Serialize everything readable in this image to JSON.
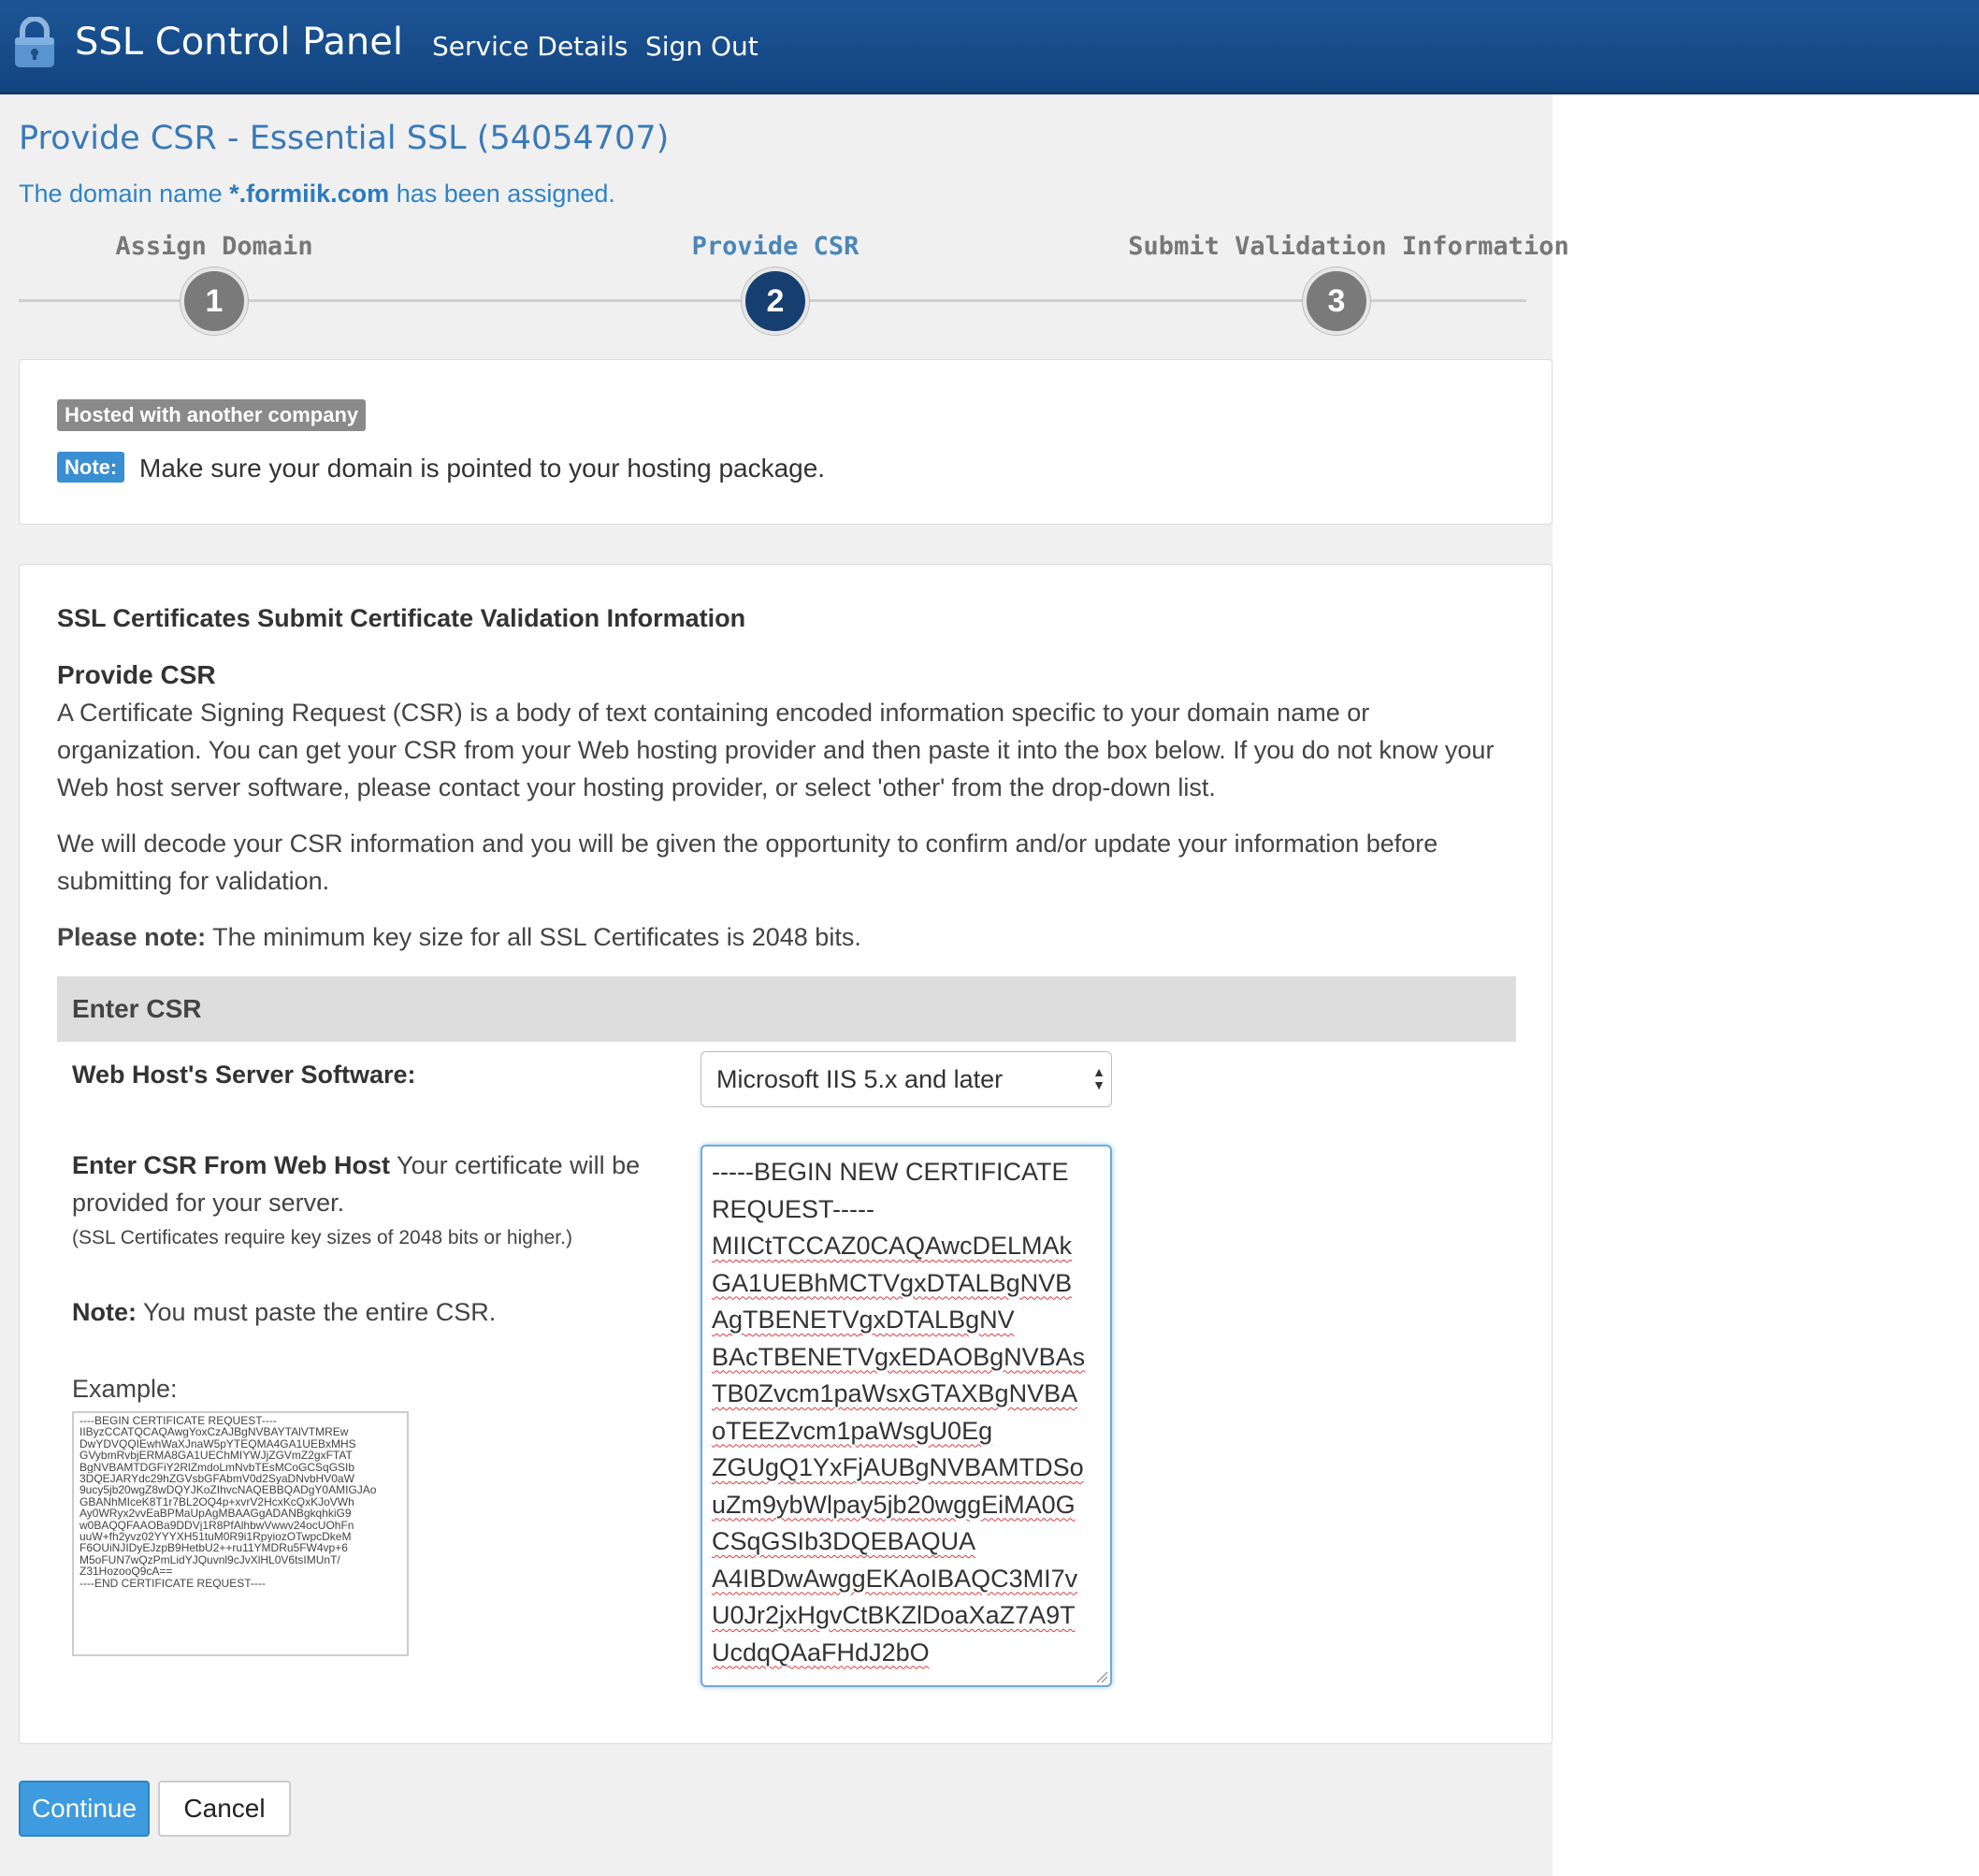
{
  "nav": {
    "brand": "SSL Control Panel",
    "links": [
      "Service Details",
      "Sign Out"
    ]
  },
  "page": {
    "title": "Provide CSR - Essential SSL (54054707)",
    "assigned_prefix": "The domain name",
    "assigned_domain": "*.formiik.com",
    "assigned_suffix": "has been assigned."
  },
  "steps": [
    {
      "number": "1",
      "label": "Assign Domain",
      "state": "done"
    },
    {
      "number": "2",
      "label": "Provide CSR",
      "state": "active"
    },
    {
      "number": "3",
      "label": "Submit Validation Information",
      "state": "pending"
    }
  ],
  "hosting_panel": {
    "badge": "Hosted with another company",
    "note_badge": "Note:",
    "note_text": "Make sure your domain is pointed to your hosting package."
  },
  "csr_panel": {
    "title": "SSL Certificates Submit Certificate Validation Information",
    "heading": "Provide CSR",
    "intro": "A Certificate Signing Request (CSR) is a body of text containing encoded information specific to your domain name or organization. You can get your CSR from your Web hosting provider and then paste it into the box below. If you do not know your Web host server software, please contact your hosting provider, or select 'other' from the drop-down list.",
    "decode": "We will decode your CSR information and you will be given the opportunity to confirm and/or update your information before submitting for validation.",
    "please_note_label": "Please note:",
    "please_note_text": "The minimum key size for all SSL Certificates is 2048 bits.",
    "enter_csr_header": "Enter CSR",
    "server_software_label": "Web Host's Server Software:",
    "server_software_value": "Microsoft IIS 5.x and later",
    "enter_csr_label": "Enter CSR From Web Host",
    "enter_csr_desc": "Your certificate will be provided for your server.",
    "key_size_hint": "(SSL Certificates require key sizes of 2048 bits or higher.)",
    "note_label": "Note:",
    "note_text": "You must paste the entire CSR.",
    "example_label": "Example:",
    "example_lines": [
      "----BEGIN CERTIFICATE REQUEST----",
      "IIByzCCATQCAQAwgYoxCzAJBgNVBAYTAlVTMREw",
      "DwYDVQQIEwhWaXJnaW5pYTEQMA4GA1UEBxMHS",
      "GVybmRvbjERMA8GA1UEChMIYWJjZGVmZ2gxFTAT",
      "BgNVBAMTDGFiY2RlZmdoLmNvbTEsMCoGCSqGSIb",
      "3DQEJARYdc29hZGVsbGFAbmV0d2SyaDNvbHV0aW",
      "9ucy5jb20wgZ8wDQYJKoZIhvcNAQEBBQADgY0AMIGJAo",
      "GBANhMIceK8T1r7BL2OQ4p+xvrV2HcxKcQxKJoVWh",
      "Ay0WRyx2vvEaBPMaUpAgMBAAGgADANBgkqhkiG9",
      "w0BAQQFAAOBa9DDVj1R8PfAlhbwVwwv24ocUOhFn",
      "uuW+fh2yvz02YYYXH51tuM0R9i1RpyiozOTwpcDkeM",
      "F6OUiNJIDyEJzpB9HetbU2++ru11YMDRu5FW4vp+6",
      "M5oFUN7wQzPmLidYJQuvnl9cJvXlHL0V6tsIMUnT/",
      "Z31HozooQ9cA==",
      "----END CERTIFICATE REQUEST----"
    ],
    "csr_lines": [
      "-----BEGIN NEW CERTIFICATE",
      "REQUEST-----",
      "MIICtTCCAZ0CAQAwcDELMAk",
      "GA1UEBhMCTVgxDTALBgNVB",
      "AgTBENETVgxDTALBgNV",
      "BAcTBENETVgxEDAOBgNVBAs",
      "TB0Zvcm1paWsxGTAXBgNVBA",
      "oTEEZvcm1paWsgU0Eg",
      "ZGUgQ1YxFjAUBgNVBAMTDSo",
      "uZm9ybWlpay5jb20wggEiMA0G",
      "CSqGSIb3DQEBAQUA",
      "A4IBDwAwggEKAoIBAQC3MI7v",
      "U0Jr2jxHgvCtBKZlDoaXaZ7A9T",
      "UcdqQAaFHdJ2bO"
    ]
  },
  "buttons": {
    "continue": "Continue",
    "cancel": "Cancel"
  }
}
